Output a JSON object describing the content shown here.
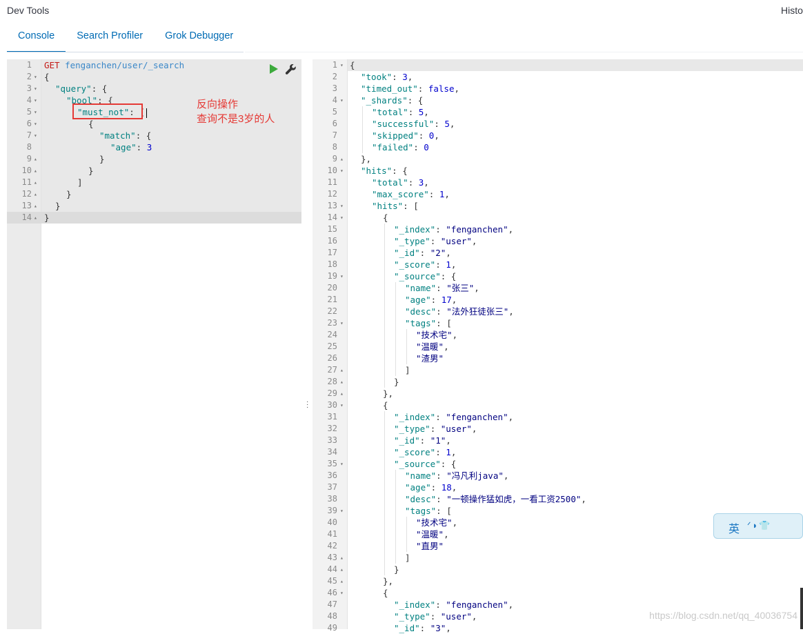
{
  "app": {
    "title": "Dev Tools",
    "history_label": "History"
  },
  "tabs": [
    {
      "label": "Console",
      "active": true
    },
    {
      "label": "Search Profiler",
      "active": false
    },
    {
      "label": "Grok Debugger",
      "active": false
    }
  ],
  "request": {
    "lines": [
      {
        "n": "1",
        "fold": "",
        "indent": 0,
        "parts": [
          [
            "m",
            "GET "
          ],
          [
            "u",
            "fenganchen/user/_search"
          ]
        ]
      },
      {
        "n": "2",
        "fold": "▾",
        "indent": 0,
        "parts": [
          [
            "p",
            "{"
          ]
        ]
      },
      {
        "n": "3",
        "fold": "▾",
        "indent": 1,
        "parts": [
          [
            "k",
            "\"query\""
          ],
          [
            "p",
            ": {"
          ]
        ]
      },
      {
        "n": "4",
        "fold": "▾",
        "indent": 2,
        "parts": [
          [
            "k",
            "\"bool\""
          ],
          [
            "p",
            ": {"
          ]
        ]
      },
      {
        "n": "5",
        "fold": "▾",
        "indent": 3,
        "parts": [
          [
            "k",
            "\"must_not\""
          ],
          [
            "p",
            ": ["
          ]
        ]
      },
      {
        "n": "6",
        "fold": "▾",
        "indent": 4,
        "parts": [
          [
            "p",
            "{"
          ]
        ]
      },
      {
        "n": "7",
        "fold": "▾",
        "indent": 5,
        "parts": [
          [
            "k",
            "\"match\""
          ],
          [
            "p",
            ": {"
          ]
        ]
      },
      {
        "n": "8",
        "fold": "",
        "indent": 6,
        "parts": [
          [
            "k",
            "\"age\""
          ],
          [
            "p",
            ": "
          ],
          [
            "n",
            "3"
          ]
        ]
      },
      {
        "n": "9",
        "fold": "▴",
        "indent": 5,
        "parts": [
          [
            "p",
            "}"
          ]
        ]
      },
      {
        "n": "10",
        "fold": "▴",
        "indent": 4,
        "parts": [
          [
            "p",
            "}"
          ]
        ]
      },
      {
        "n": "11",
        "fold": "▴",
        "indent": 3,
        "parts": [
          [
            "p",
            "]"
          ]
        ]
      },
      {
        "n": "12",
        "fold": "▴",
        "indent": 2,
        "parts": [
          [
            "p",
            "}"
          ]
        ]
      },
      {
        "n": "13",
        "fold": "▴",
        "indent": 1,
        "parts": [
          [
            "p",
            "}"
          ]
        ]
      },
      {
        "n": "14",
        "fold": "▴",
        "indent": 0,
        "parts": [
          [
            "p",
            "}"
          ]
        ]
      }
    ]
  },
  "annotation": {
    "line1": "反向操作",
    "line2": "查询不是3岁的人"
  },
  "response": {
    "lines": [
      {
        "n": "1",
        "fold": "▾",
        "indent": 0,
        "parts": [
          [
            "p",
            "{"
          ]
        ]
      },
      {
        "n": "2",
        "fold": "",
        "indent": 1,
        "parts": [
          [
            "k",
            "\"took\""
          ],
          [
            "p",
            ": "
          ],
          [
            "n",
            "3"
          ],
          [
            "p",
            ","
          ]
        ]
      },
      {
        "n": "3",
        "fold": "",
        "indent": 1,
        "parts": [
          [
            "k",
            "\"timed_out\""
          ],
          [
            "p",
            ": "
          ],
          [
            "b",
            "false"
          ],
          [
            "p",
            ","
          ]
        ]
      },
      {
        "n": "4",
        "fold": "▾",
        "indent": 1,
        "parts": [
          [
            "k",
            "\"_shards\""
          ],
          [
            "p",
            ": {"
          ]
        ]
      },
      {
        "n": "5",
        "fold": "",
        "indent": 2,
        "parts": [
          [
            "k",
            "\"total\""
          ],
          [
            "p",
            ": "
          ],
          [
            "n",
            "5"
          ],
          [
            "p",
            ","
          ]
        ]
      },
      {
        "n": "6",
        "fold": "",
        "indent": 2,
        "parts": [
          [
            "k",
            "\"successful\""
          ],
          [
            "p",
            ": "
          ],
          [
            "n",
            "5"
          ],
          [
            "p",
            ","
          ]
        ]
      },
      {
        "n": "7",
        "fold": "",
        "indent": 2,
        "parts": [
          [
            "k",
            "\"skipped\""
          ],
          [
            "p",
            ": "
          ],
          [
            "n",
            "0"
          ],
          [
            "p",
            ","
          ]
        ]
      },
      {
        "n": "8",
        "fold": "",
        "indent": 2,
        "parts": [
          [
            "k",
            "\"failed\""
          ],
          [
            "p",
            ": "
          ],
          [
            "n",
            "0"
          ]
        ]
      },
      {
        "n": "9",
        "fold": "▴",
        "indent": 1,
        "parts": [
          [
            "p",
            "},"
          ]
        ]
      },
      {
        "n": "10",
        "fold": "▾",
        "indent": 1,
        "parts": [
          [
            "k",
            "\"hits\""
          ],
          [
            "p",
            ": {"
          ]
        ]
      },
      {
        "n": "11",
        "fold": "",
        "indent": 2,
        "parts": [
          [
            "k",
            "\"total\""
          ],
          [
            "p",
            ": "
          ],
          [
            "n",
            "3"
          ],
          [
            "p",
            ","
          ]
        ]
      },
      {
        "n": "12",
        "fold": "",
        "indent": 2,
        "parts": [
          [
            "k",
            "\"max_score\""
          ],
          [
            "p",
            ": "
          ],
          [
            "n",
            "1"
          ],
          [
            "p",
            ","
          ]
        ]
      },
      {
        "n": "13",
        "fold": "▾",
        "indent": 2,
        "parts": [
          [
            "k",
            "\"hits\""
          ],
          [
            "p",
            ": ["
          ]
        ]
      },
      {
        "n": "14",
        "fold": "▾",
        "indent": 3,
        "parts": [
          [
            "p",
            "{"
          ]
        ]
      },
      {
        "n": "15",
        "fold": "",
        "indent": 4,
        "parts": [
          [
            "k",
            "\"_index\""
          ],
          [
            "p",
            ": "
          ],
          [
            "s",
            "\"fenganchen\""
          ],
          [
            "p",
            ","
          ]
        ]
      },
      {
        "n": "16",
        "fold": "",
        "indent": 4,
        "parts": [
          [
            "k",
            "\"_type\""
          ],
          [
            "p",
            ": "
          ],
          [
            "s",
            "\"user\""
          ],
          [
            "p",
            ","
          ]
        ]
      },
      {
        "n": "17",
        "fold": "",
        "indent": 4,
        "parts": [
          [
            "k",
            "\"_id\""
          ],
          [
            "p",
            ": "
          ],
          [
            "s",
            "\"2\""
          ],
          [
            "p",
            ","
          ]
        ]
      },
      {
        "n": "18",
        "fold": "",
        "indent": 4,
        "parts": [
          [
            "k",
            "\"_score\""
          ],
          [
            "p",
            ": "
          ],
          [
            "n",
            "1"
          ],
          [
            "p",
            ","
          ]
        ]
      },
      {
        "n": "19",
        "fold": "▾",
        "indent": 4,
        "parts": [
          [
            "k",
            "\"_source\""
          ],
          [
            "p",
            ": {"
          ]
        ]
      },
      {
        "n": "20",
        "fold": "",
        "indent": 5,
        "parts": [
          [
            "k",
            "\"name\""
          ],
          [
            "p",
            ": "
          ],
          [
            "s",
            "\"张三\""
          ],
          [
            "p",
            ","
          ]
        ]
      },
      {
        "n": "21",
        "fold": "",
        "indent": 5,
        "parts": [
          [
            "k",
            "\"age\""
          ],
          [
            "p",
            ": "
          ],
          [
            "n",
            "17"
          ],
          [
            "p",
            ","
          ]
        ]
      },
      {
        "n": "22",
        "fold": "",
        "indent": 5,
        "parts": [
          [
            "k",
            "\"desc\""
          ],
          [
            "p",
            ": "
          ],
          [
            "s",
            "\"法外狂徒张三\""
          ],
          [
            "p",
            ","
          ]
        ]
      },
      {
        "n": "23",
        "fold": "▾",
        "indent": 5,
        "parts": [
          [
            "k",
            "\"tags\""
          ],
          [
            "p",
            ": ["
          ]
        ]
      },
      {
        "n": "24",
        "fold": "",
        "indent": 6,
        "parts": [
          [
            "s",
            "\"技术宅\""
          ],
          [
            "p",
            ","
          ]
        ]
      },
      {
        "n": "25",
        "fold": "",
        "indent": 6,
        "parts": [
          [
            "s",
            "\"温暖\""
          ],
          [
            "p",
            ","
          ]
        ]
      },
      {
        "n": "26",
        "fold": "",
        "indent": 6,
        "parts": [
          [
            "s",
            "\"渣男\""
          ]
        ]
      },
      {
        "n": "27",
        "fold": "▴",
        "indent": 5,
        "parts": [
          [
            "p",
            "]"
          ]
        ]
      },
      {
        "n": "28",
        "fold": "▴",
        "indent": 4,
        "parts": [
          [
            "p",
            "}"
          ]
        ]
      },
      {
        "n": "29",
        "fold": "▴",
        "indent": 3,
        "parts": [
          [
            "p",
            "},"
          ]
        ]
      },
      {
        "n": "30",
        "fold": "▾",
        "indent": 3,
        "parts": [
          [
            "p",
            "{"
          ]
        ]
      },
      {
        "n": "31",
        "fold": "",
        "indent": 4,
        "parts": [
          [
            "k",
            "\"_index\""
          ],
          [
            "p",
            ": "
          ],
          [
            "s",
            "\"fenganchen\""
          ],
          [
            "p",
            ","
          ]
        ]
      },
      {
        "n": "32",
        "fold": "",
        "indent": 4,
        "parts": [
          [
            "k",
            "\"_type\""
          ],
          [
            "p",
            ": "
          ],
          [
            "s",
            "\"user\""
          ],
          [
            "p",
            ","
          ]
        ]
      },
      {
        "n": "33",
        "fold": "",
        "indent": 4,
        "parts": [
          [
            "k",
            "\"_id\""
          ],
          [
            "p",
            ": "
          ],
          [
            "s",
            "\"1\""
          ],
          [
            "p",
            ","
          ]
        ]
      },
      {
        "n": "34",
        "fold": "",
        "indent": 4,
        "parts": [
          [
            "k",
            "\"_score\""
          ],
          [
            "p",
            ": "
          ],
          [
            "n",
            "1"
          ],
          [
            "p",
            ","
          ]
        ]
      },
      {
        "n": "35",
        "fold": "▾",
        "indent": 4,
        "parts": [
          [
            "k",
            "\"_source\""
          ],
          [
            "p",
            ": {"
          ]
        ]
      },
      {
        "n": "36",
        "fold": "",
        "indent": 5,
        "parts": [
          [
            "k",
            "\"name\""
          ],
          [
            "p",
            ": "
          ],
          [
            "s",
            "\"冯凡利java\""
          ],
          [
            "p",
            ","
          ]
        ]
      },
      {
        "n": "37",
        "fold": "",
        "indent": 5,
        "parts": [
          [
            "k",
            "\"age\""
          ],
          [
            "p",
            ": "
          ],
          [
            "n",
            "18"
          ],
          [
            "p",
            ","
          ]
        ]
      },
      {
        "n": "38",
        "fold": "",
        "indent": 5,
        "parts": [
          [
            "k",
            "\"desc\""
          ],
          [
            "p",
            ": "
          ],
          [
            "s",
            "\"一顿操作猛如虎，一看工资2500\""
          ],
          [
            "p",
            ","
          ]
        ]
      },
      {
        "n": "39",
        "fold": "▾",
        "indent": 5,
        "parts": [
          [
            "k",
            "\"tags\""
          ],
          [
            "p",
            ": ["
          ]
        ]
      },
      {
        "n": "40",
        "fold": "",
        "indent": 6,
        "parts": [
          [
            "s",
            "\"技术宅\""
          ],
          [
            "p",
            ","
          ]
        ]
      },
      {
        "n": "41",
        "fold": "",
        "indent": 6,
        "parts": [
          [
            "s",
            "\"温暖\""
          ],
          [
            "p",
            ","
          ]
        ]
      },
      {
        "n": "42",
        "fold": "",
        "indent": 6,
        "parts": [
          [
            "s",
            "\"直男\""
          ]
        ]
      },
      {
        "n": "43",
        "fold": "▴",
        "indent": 5,
        "parts": [
          [
            "p",
            "]"
          ]
        ]
      },
      {
        "n": "44",
        "fold": "▴",
        "indent": 4,
        "parts": [
          [
            "p",
            "}"
          ]
        ]
      },
      {
        "n": "45",
        "fold": "▴",
        "indent": 3,
        "parts": [
          [
            "p",
            "},"
          ]
        ]
      },
      {
        "n": "46",
        "fold": "▾",
        "indent": 3,
        "parts": [
          [
            "p",
            "{"
          ]
        ]
      },
      {
        "n": "47",
        "fold": "",
        "indent": 4,
        "parts": [
          [
            "k",
            "\"_index\""
          ],
          [
            "p",
            ": "
          ],
          [
            "s",
            "\"fenganchen\""
          ],
          [
            "p",
            ","
          ]
        ]
      },
      {
        "n": "48",
        "fold": "",
        "indent": 4,
        "parts": [
          [
            "k",
            "\"_type\""
          ],
          [
            "p",
            ": "
          ],
          [
            "s",
            "\"user\""
          ],
          [
            "p",
            ","
          ]
        ]
      },
      {
        "n": "49",
        "fold": "",
        "indent": 4,
        "parts": [
          [
            "k",
            "\"_id\""
          ],
          [
            "p",
            ": "
          ],
          [
            "s",
            "\"3\""
          ],
          [
            "p",
            ","
          ]
        ]
      }
    ]
  },
  "ime": {
    "label": "英",
    "icons": "ᐟ◗👕"
  },
  "watermark": "https://blog.csdn.net/qq_40036754",
  "icons": {
    "run": "play-icon",
    "settings": "wrench-icon",
    "resize": "vertical-dots-icon"
  },
  "colors": {
    "accent": "#006bb4",
    "annotation": "#e53935",
    "key": "#008080",
    "string": "#000080",
    "number": "#0000cd",
    "method": "#c41a16"
  }
}
